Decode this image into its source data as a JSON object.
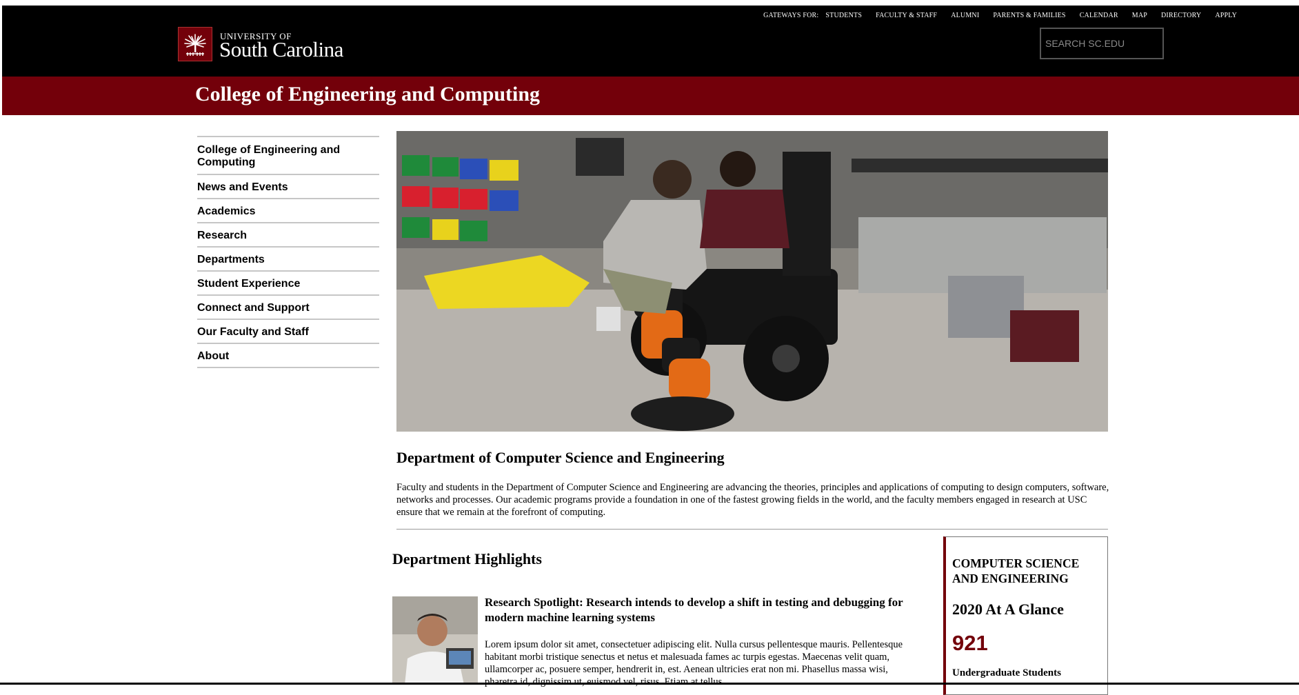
{
  "header": {
    "gateways_label": "GATEWAYS FOR:",
    "gateway_links": [
      "STUDENTS",
      "FACULTY & STAFF",
      "ALUMNI",
      "PARENTS & FAMILIES",
      "CALENDAR",
      "MAP",
      "DIRECTORY",
      "APPLY"
    ],
    "logo_small": "UNIVERSITY OF",
    "logo_big": "South Carolina",
    "search_placeholder": "SEARCH SC.EDU"
  },
  "college": {
    "title": "College of Engineering and Computing"
  },
  "sidenav": {
    "items": [
      "College of Engineering and Computing",
      "News and Events",
      "Academics",
      "Research",
      "Departments",
      "Student Experience",
      "Connect and Support",
      "Our Faculty and Staff",
      "About"
    ]
  },
  "main": {
    "dept_title": "Department of Computer Science and Engineering",
    "dept_description": "Faculty and students in the Department of Computer Science and Engineering are advancing the theories, principles and applications of computing to design computers, software, networks and processes. Our academic programs provide a foundation in one of the fastest growing fields in the world, and the faculty members engaged in research at USC ensure that we remain at the forefront of computing.",
    "highlights_title": "Department Highlights",
    "spotlight": {
      "title": "Research Spotlight: Research intends to develop a shift in testing and debugging for modern machine learning systems",
      "body": "Lorem ipsum dolor sit amet, consectetuer adipiscing elit. Nulla cursus pellentesque mauris. Pellentesque habitant morbi tristique senectus et netus et malesuada fames ac turpis egestas. Maecenas velit quam, ullamcorper ac, posuere semper, hendrerit in, est. Aenean ultricies erat non mi. Phasellus massa wisi, pharetra id, dignissim ut, euismod vel, risus. Etiam at tellus"
    }
  },
  "glance": {
    "heading": "COMPUTER SCIENCE AND ENGINEERING",
    "subheading": "2020 At A Glance",
    "stat_value": "921",
    "stat_label": "Undergraduate Students"
  },
  "colors": {
    "garnet": "#73000a",
    "black": "#000000",
    "white": "#ffffff"
  },
  "icons": {
    "logo": "palmetto-tree-icon"
  }
}
